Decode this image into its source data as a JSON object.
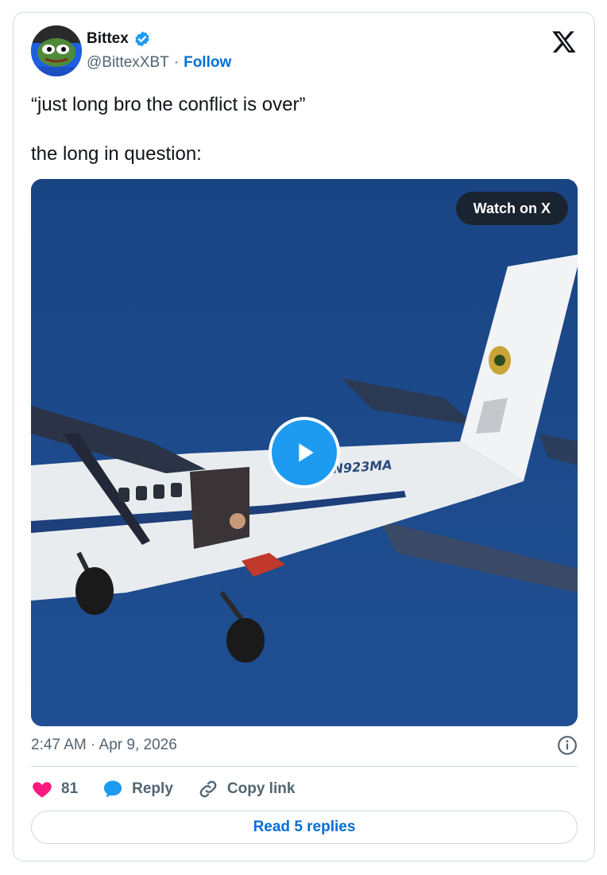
{
  "author": {
    "name": "Bittex",
    "handle": "@BittexXBT",
    "separator": "·",
    "follow_label": "Follow"
  },
  "tweet": {
    "line1": "“just long bro the conflict is over”",
    "line2": "the long in question:"
  },
  "media": {
    "watch_label": "Watch on X",
    "tail_number": "N923MA"
  },
  "timestamp": "2:47 AM · Apr 9, 2026",
  "actions": {
    "likes": "81",
    "reply_label": "Reply",
    "copy_link_label": "Copy link"
  },
  "read_replies_label": "Read 5 replies",
  "colors": {
    "accent": "#1d9bf0",
    "link": "#006fd6",
    "like": "#f91880",
    "sky": "#1c4a8a"
  },
  "icons": [
    "verified-badge-icon",
    "x-logo-icon",
    "play-icon",
    "info-icon",
    "heart-icon",
    "reply-bubble-icon",
    "link-icon"
  ]
}
